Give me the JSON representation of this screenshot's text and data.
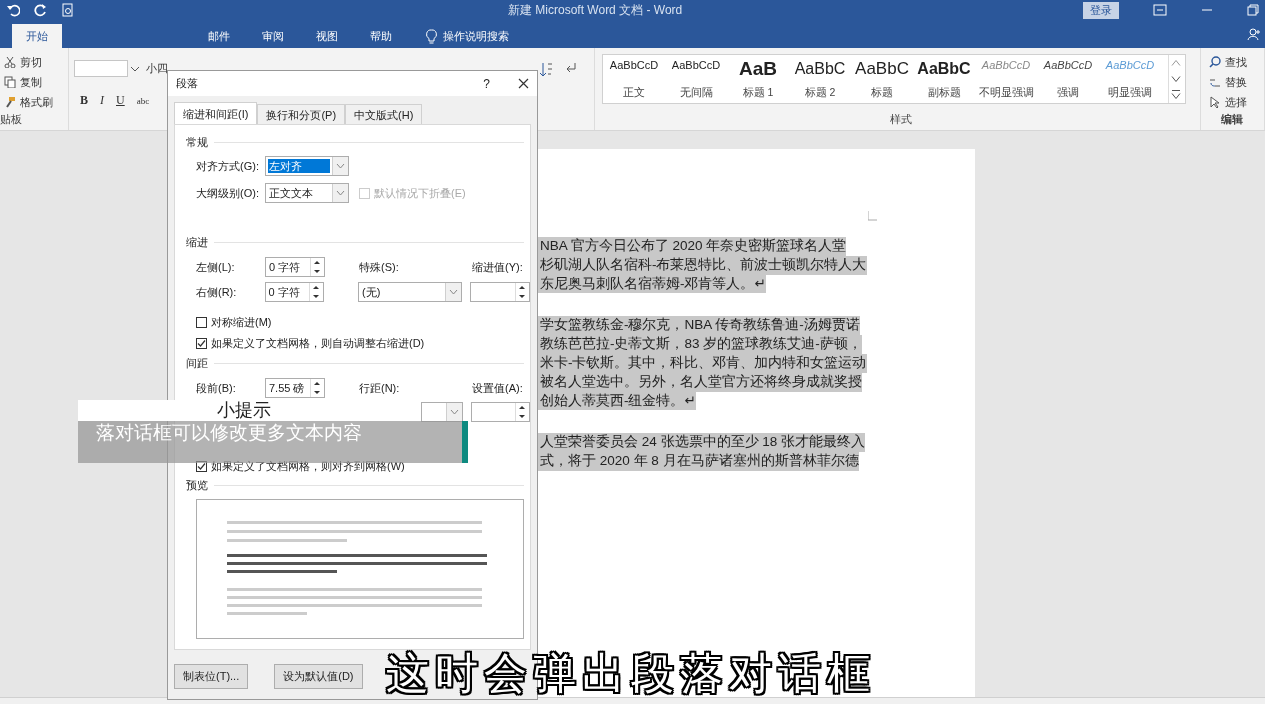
{
  "window": {
    "title": "新建 Microsoft Word 文档 - Word",
    "sign_in": "登录"
  },
  "ribbon_tabs": [
    {
      "label": "开始",
      "selected": true
    },
    {
      "label": "邮件",
      "selected": false
    },
    {
      "label": "审阅",
      "selected": false
    },
    {
      "label": "视图",
      "selected": false
    },
    {
      "label": "帮助",
      "selected": false
    }
  ],
  "tell_me": "操作说明搜索",
  "clipboard": {
    "items": [
      "剪切",
      "复制",
      "格式刷"
    ],
    "group": "贴板"
  },
  "font": {
    "size": "小四",
    "format_buttons": [
      "B",
      "I",
      "U",
      "abc"
    ]
  },
  "styles": {
    "items": [
      {
        "preview": "AaBbCcD",
        "name": "正文",
        "kind": "normal"
      },
      {
        "preview": "AaBbCcD",
        "name": "无间隔",
        "kind": "normal"
      },
      {
        "preview": "AaB",
        "name": "标题 1",
        "kind": "heading1"
      },
      {
        "preview": "AaBbC",
        "name": "标题 2",
        "kind": "heading2"
      },
      {
        "preview": "AaBbC",
        "name": "标题",
        "kind": "title"
      },
      {
        "preview": "AaBbC",
        "name": "副标题",
        "kind": "subtitle"
      },
      {
        "preview": "AaBbCcD",
        "name": "不明显强调",
        "kind": "subtle"
      },
      {
        "preview": "AaBbCcD",
        "name": "强调",
        "kind": "emphasis"
      },
      {
        "preview": "AaBbCcD",
        "name": "明显强调",
        "kind": "intense"
      }
    ],
    "group": "样式"
  },
  "editing": {
    "items": [
      "查找",
      "替换",
      "选择"
    ],
    "group": "编辑"
  },
  "dialog": {
    "title": "段落",
    "help": "?",
    "tabs": [
      {
        "label": "缩进和间距(I)",
        "selected": true
      },
      {
        "label": "换行和分页(P)",
        "selected": false
      },
      {
        "label": "中文版式(H)",
        "selected": false
      }
    ],
    "general": {
      "heading": "常规",
      "alignment": {
        "label": "对齐方式(G):",
        "value": "左对齐"
      },
      "outline": {
        "label": "大纲级别(O):",
        "value": "正文文本"
      },
      "collapse": {
        "label": "默认情况下折叠(E)",
        "checked": false,
        "disabled": true
      }
    },
    "indent": {
      "heading": "缩进",
      "left": {
        "label": "左侧(L):",
        "value": "0 字符"
      },
      "right": {
        "label": "右侧(R):",
        "value": "0 字符"
      },
      "special": {
        "label": "特殊(S):",
        "value": "(无)"
      },
      "by": {
        "label": "缩进值(Y):"
      },
      "mirror": {
        "label": "对称缩进(M)",
        "checked": false
      },
      "auto_right": {
        "label": "如果定义了文档网格，则自动调整右缩进(D)",
        "checked": true
      }
    },
    "spacing": {
      "heading": "间距",
      "before": {
        "label": "段前(B):",
        "value": "7.55 磅"
      },
      "line": {
        "label": "行距(N):"
      },
      "at": {
        "label": "设置值(A):"
      },
      "snap": {
        "label": "如果定义了文档网格，则对齐到网格(W)",
        "checked": true
      }
    },
    "preview": {
      "heading": "预览"
    },
    "buttons": [
      "制表位(T)...",
      "设为默认值(D)"
    ]
  },
  "document": {
    "paragraphs": [
      [
        "NBA 官方今日公布了 2020 年奈史密斯篮球名人堂",
        "杉矶湖人队名宿科-布莱恩特比、前波士顿凯尔特人大",
        "东尼奥马刺队名宿蒂姆-邓肯等人。↵"
      ],
      [
        "学女篮教练金-穆尔克，NBA 传奇教练鲁迪-汤姆贾诺",
        "教练芭芭拉-史蒂文斯，83 岁的篮球教练艾迪-萨顿，",
        "米卡-卡钦斯。其中，科比、邓肯、加内特和女篮运动",
        "被名人堂选中。另外，名人堂官方还将终身成就奖授",
        "创始人蒂莫西-纽金特。↵"
      ],
      [
        "人堂荣誉委员会 24 张选票中的至少 18 张才能最终入",
        "式，将于 2020 年 8 月在马萨诸塞州的斯普林菲尔德"
      ]
    ],
    "selected": true
  },
  "tip": {
    "title": "小提示",
    "text": "落对话框可以修改更多文本内容"
  },
  "subtitle": "这时会弹出段落对话框"
}
